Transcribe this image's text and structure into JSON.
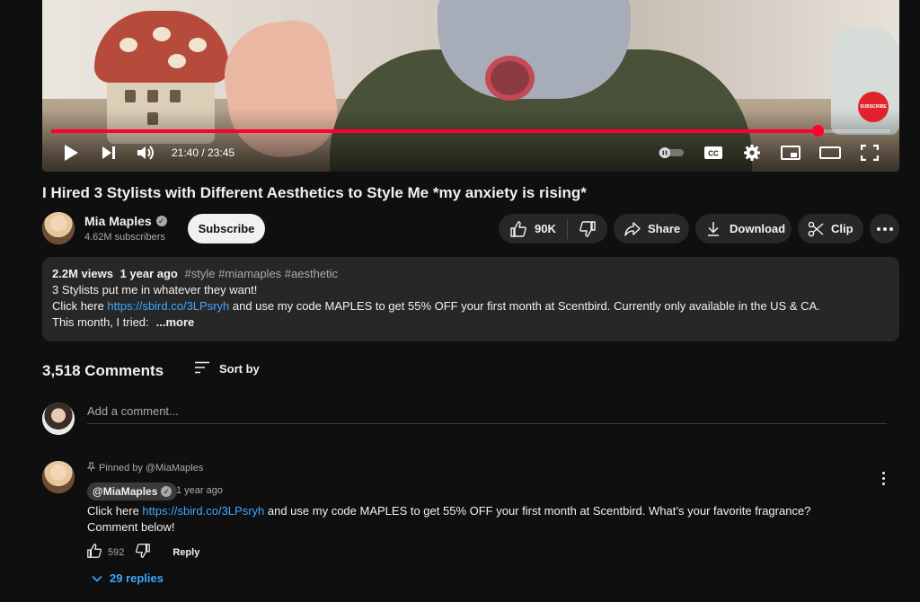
{
  "player": {
    "time_current": "21:40",
    "time_total": "23:45",
    "time_label": "21:40 / 23:45",
    "progress": 0.913,
    "subscribe_watermark": "SUBSCRIBE",
    "accent_color": "#ff0033"
  },
  "video": {
    "title": "I Hired 3 Stylists with Different Aesthetics to Style Me *my anxiety is rising*"
  },
  "channel": {
    "name": "Mia Maples",
    "subscribers": "4.62M subscribers",
    "subscribe_label": "Subscribe"
  },
  "actions": {
    "likes": "90K",
    "share": "Share",
    "download": "Download",
    "clip": "Clip"
  },
  "description": {
    "views": "2.2M views",
    "age": "1 year ago",
    "tags": "#style #miamaples #aesthetic",
    "line1": "3 Stylists put me in whatever they want!",
    "line2_pre": "Click here ",
    "line2_link": "https://sbird.co/3LPsryh",
    "line2_post": " and use my code MAPLES to get 55% OFF your first month at Scentbird. Currently only available in the US & CA.",
    "line3": "This month, I tried:",
    "more": "...more"
  },
  "comments": {
    "count": "3,518 Comments",
    "sort_label": "Sort by",
    "add_placeholder": "Add a comment...",
    "pinned": {
      "pinned_by": "Pinned by @MiaMaples",
      "author": "@MiaMaples",
      "time": "1 year ago",
      "text_pre": "Click here ",
      "link": "https://sbird.co/3LPsryh",
      "text_post": "  and use my code MAPLES to get 55% OFF your first month at Scentbird. What’s your favorite fragrance? Comment below!",
      "likes": "592",
      "reply_label": "Reply",
      "replies_label": "29 replies"
    }
  }
}
